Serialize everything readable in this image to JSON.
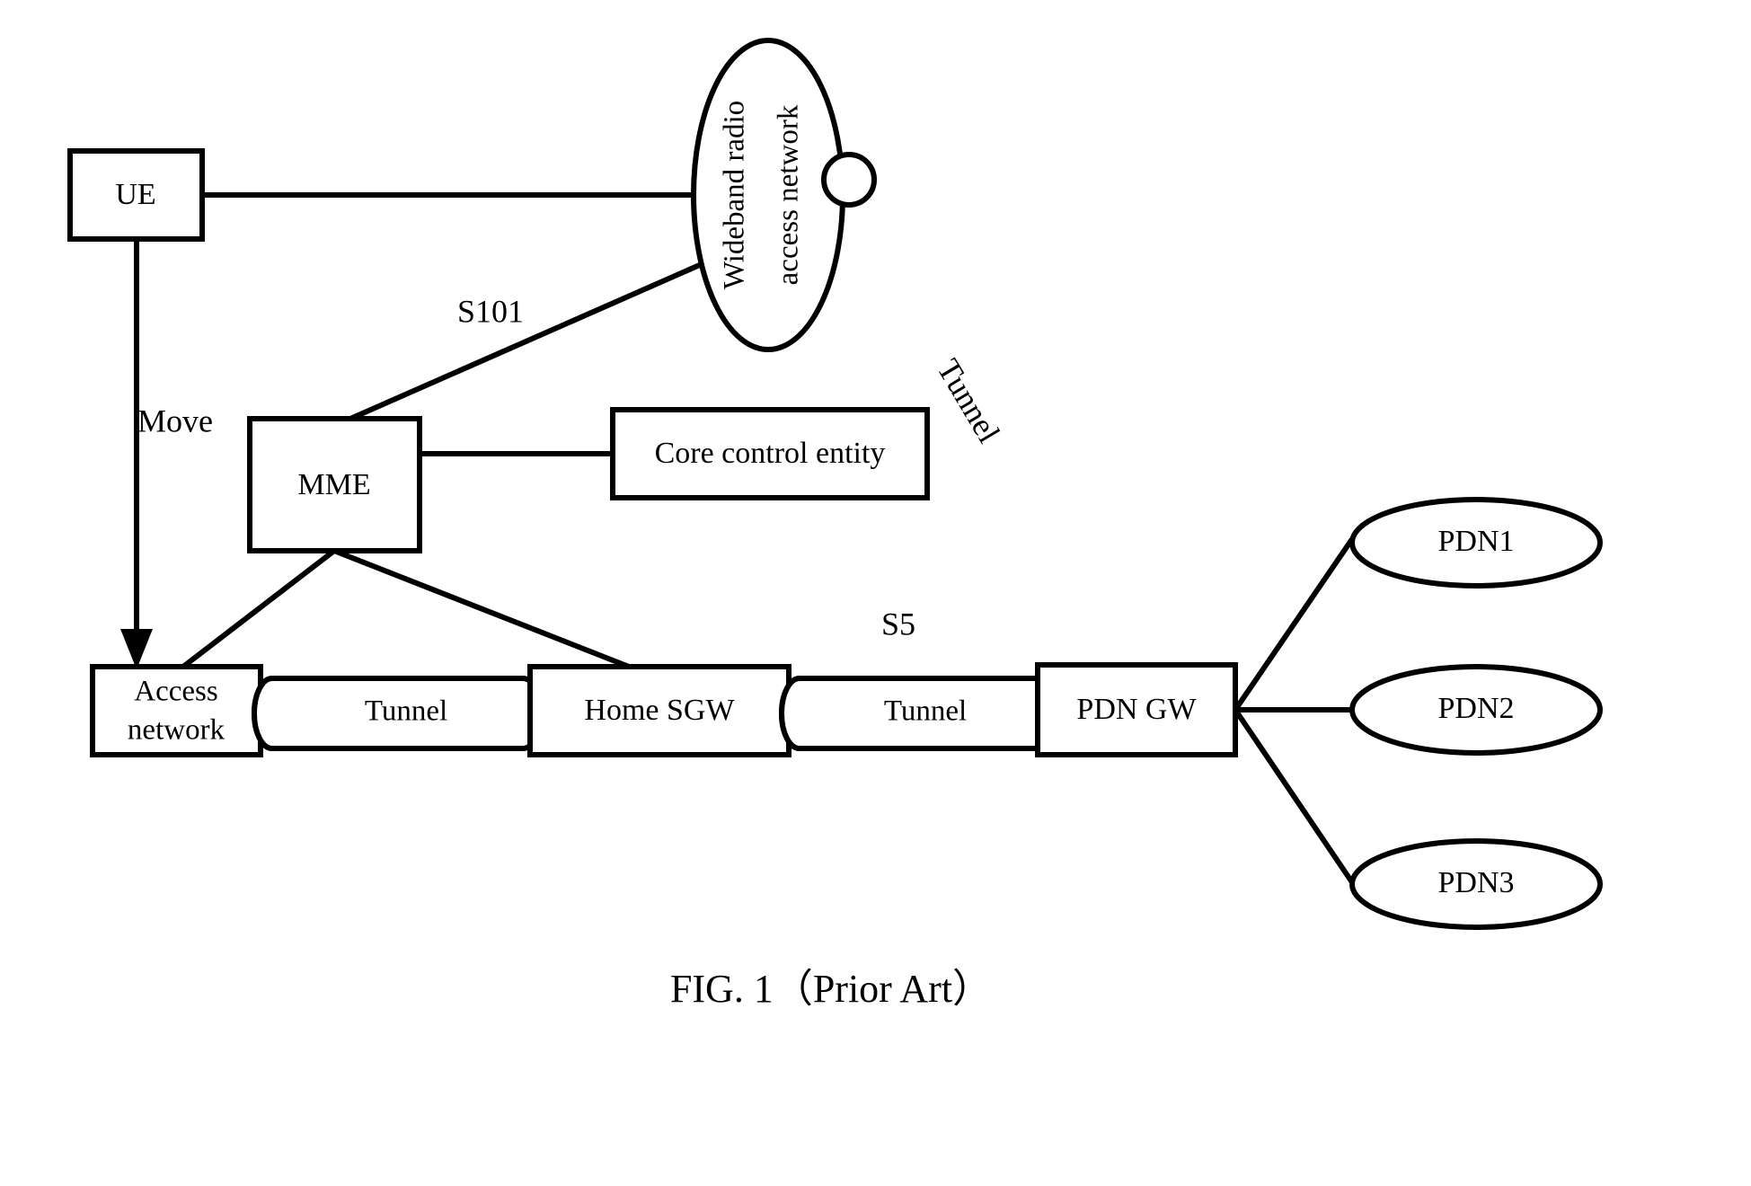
{
  "figure": {
    "caption": "FIG. 1（Prior Art）",
    "background_color": "#ffffff",
    "line_color": "#000000"
  },
  "nodes": {
    "ue": {
      "label": "UE",
      "shape": "rectangle"
    },
    "wideband_radio_access_network": {
      "label_line1": "Wideband radio",
      "label_line2": "access network",
      "shape": "ellipse",
      "text_orientation": "vertical-rotated-90ccw"
    },
    "mme": {
      "label": "MME",
      "shape": "rectangle"
    },
    "core_control_entity": {
      "label": "Core control entity",
      "shape": "rectangle"
    },
    "access_network": {
      "label_line1": "Access",
      "label_line2": "network",
      "shape": "rectangle"
    },
    "tunnel_access_to_sgw": {
      "label": "Tunnel",
      "shape": "cylinder"
    },
    "home_sgw": {
      "label": "Home SGW",
      "shape": "rectangle"
    },
    "tunnel_sgw_to_pdngw": {
      "label": "Tunnel",
      "shape": "cylinder"
    },
    "pdn_gw": {
      "label": "PDN GW",
      "shape": "rectangle"
    },
    "tunnel_diagonal": {
      "label": "Tunnel",
      "shape": "capsule",
      "text_orientation": "rotated-along-axis"
    },
    "pdn1": {
      "label": "PDN1",
      "shape": "ellipse"
    },
    "pdn2": {
      "label": "PDN2",
      "shape": "ellipse"
    },
    "pdn3": {
      "label": "PDN3",
      "shape": "ellipse"
    },
    "junction_circle": {
      "label": "",
      "shape": "circle"
    }
  },
  "edge_labels": {
    "move": "Move",
    "s101": "S101",
    "s5": "S5"
  }
}
